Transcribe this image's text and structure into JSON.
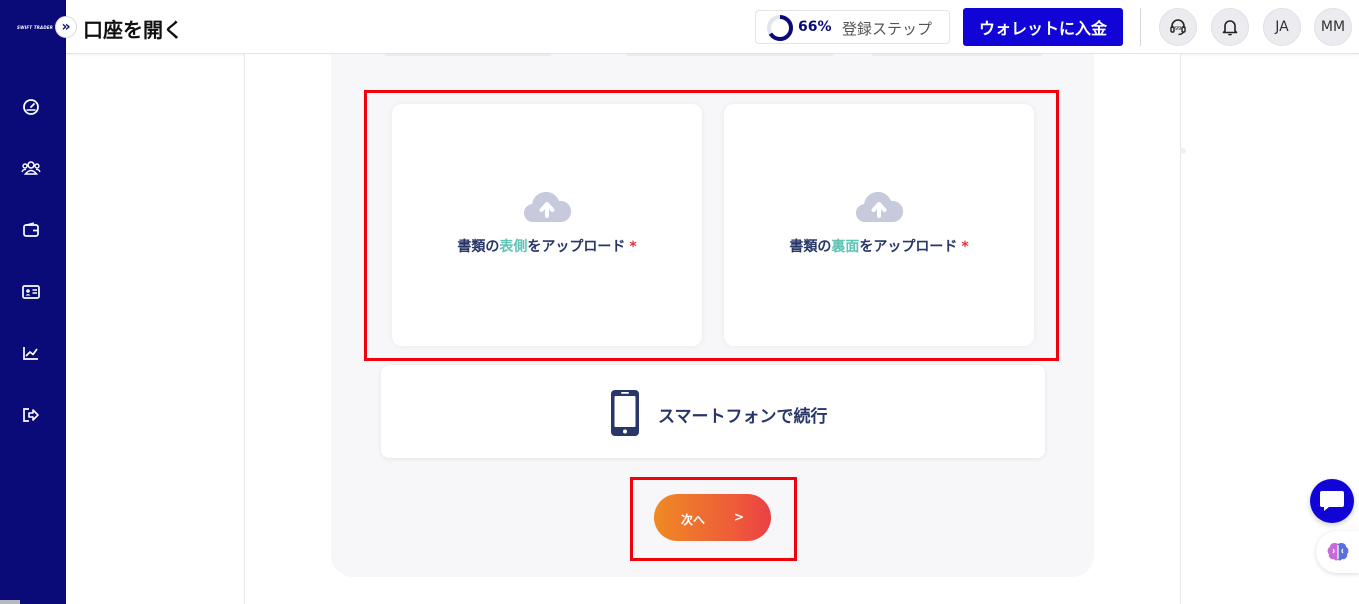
{
  "sidebar": {
    "logo_text": "SWIFT TRADER",
    "items": [
      {
        "name": "dashboard",
        "icon": "dashboard-icon"
      },
      {
        "name": "partners",
        "icon": "users-icon"
      },
      {
        "name": "wallet",
        "icon": "wallet-icon"
      },
      {
        "name": "profile",
        "icon": "id-card-icon"
      },
      {
        "name": "analytics",
        "icon": "chart-icon"
      },
      {
        "name": "logout",
        "icon": "logout-icon"
      }
    ]
  },
  "header": {
    "expand_icon": "»",
    "title": "口座を開く",
    "progress": {
      "percent": 66,
      "percent_label": "66%",
      "label": "登録ステップ"
    },
    "deposit_button": "ウォレットに入金",
    "language": "JA",
    "user_initials": "MM"
  },
  "upload": {
    "front": {
      "pre": "書類の",
      "highlight": "表側",
      "post": "をアップロード",
      "required": "*"
    },
    "back": {
      "pre": "書類の",
      "highlight": "裏面",
      "post": "をアップロード",
      "required": "*"
    }
  },
  "continue_on_phone": "スマートフォンで続行",
  "next_button": {
    "label": "次へ",
    "chevron": ">"
  },
  "colors": {
    "sidebar": "#0b0a79",
    "primary": "#1005d6",
    "highlight": "#5fc3b6",
    "required": "#e0303a",
    "next_gradient_start": "#ef8a24",
    "next_gradient_end": "#ea4045",
    "annotation": "#f0000a"
  }
}
